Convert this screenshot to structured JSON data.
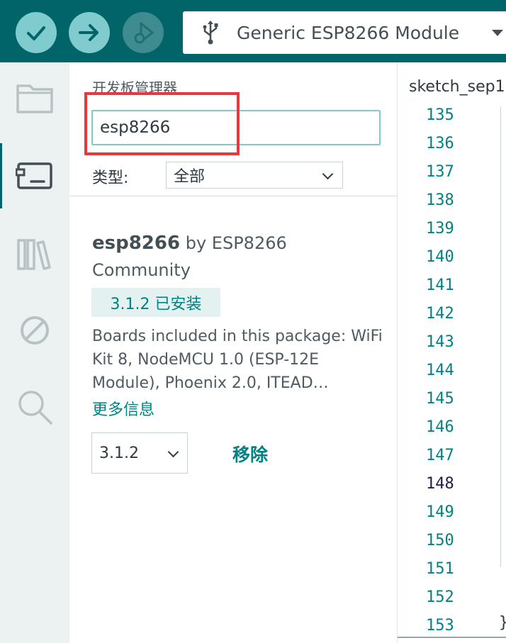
{
  "toolbar": {
    "verify_icon": "check-icon",
    "upload_icon": "arrow-right-icon",
    "debug_icon": "debug-icon",
    "board_name": "Generic ESP8266 Module",
    "usb_icon": "usb-icon"
  },
  "rail": {
    "items": [
      "folder-icon",
      "board-icon",
      "library-icon",
      "debug-disabled-icon",
      "search-icon"
    ],
    "active": "board-icon"
  },
  "boards_manager": {
    "title": "开发板管理器",
    "search_value": "esp8266",
    "type_label": "类型:",
    "type_value": "全部",
    "package": {
      "name": "esp8266",
      "by_text": "by ESP8266 Community",
      "installed_badge": "3.1.2 已安装",
      "description": "Boards included in this package: WiFi Kit 8, NodeMCU 1.0 (ESP-12E Module), Phoenix 2.0, ITEAD…",
      "more_info": "更多信息",
      "version": "3.1.2",
      "remove_label": "移除"
    }
  },
  "editor": {
    "tab_name": "sketch_sep1",
    "line_numbers": [
      "135",
      "136",
      "137",
      "138",
      "139",
      "140",
      "141",
      "142",
      "143",
      "144",
      "145",
      "146",
      "147",
      "148",
      "149",
      "150",
      "151",
      "152",
      "153"
    ],
    "current_line": "148",
    "last_line_text": "}"
  },
  "colors": {
    "toolbar_bg": "#006468",
    "accent": "#008184",
    "highlight": "#e8383d"
  }
}
